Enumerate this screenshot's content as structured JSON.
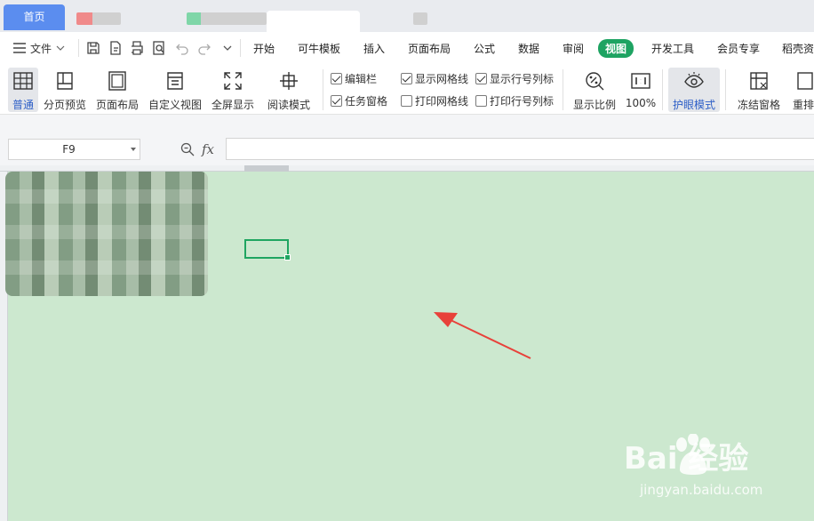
{
  "tabs": {
    "home": "首页"
  },
  "menu": {
    "file": "文件",
    "tabs": [
      "开始",
      "可牛模板",
      "插入",
      "页面布局",
      "公式",
      "数据",
      "审阅",
      "视图",
      "开发工具",
      "会员专享",
      "稻壳资"
    ],
    "active": "视图"
  },
  "ribbon": {
    "buttons": [
      "普通",
      "分页预览",
      "页面布局",
      "自定义视图",
      "全屏显示",
      "阅读模式",
      "显示比例",
      "100%",
      "护眼模式",
      "冻结窗格",
      "重排"
    ],
    "checkboxes": [
      {
        "label": "编辑栏",
        "checked": true
      },
      {
        "label": "任务窗格",
        "checked": true
      },
      {
        "label": "显示网格线",
        "checked": true
      },
      {
        "label": "打印网格线",
        "checked": false
      },
      {
        "label": "显示行号列标",
        "checked": true
      },
      {
        "label": "打印行号列标",
        "checked": false
      }
    ]
  },
  "formula_bar": {
    "cell_ref": "F9",
    "fx": "fx",
    "value": ""
  },
  "watermark": {
    "brand": "Bai 经验",
    "url": "jingyan.baidu.com"
  },
  "colors": {
    "sheet_bg": "#cce8cf",
    "accent": "#1ea362",
    "arrow": "#e8413a"
  }
}
